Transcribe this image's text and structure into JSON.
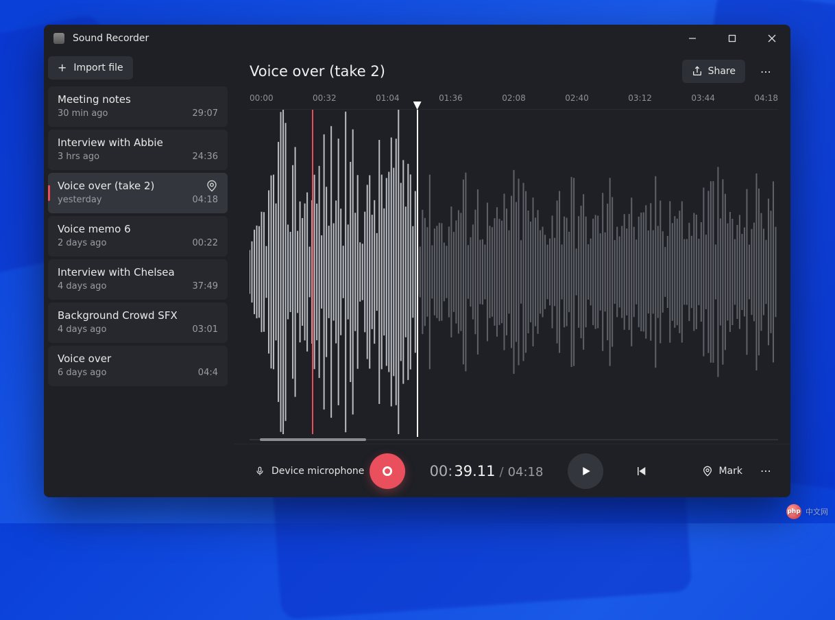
{
  "app": {
    "title": "Sound Recorder"
  },
  "window_controls": {
    "minimize": "minimize",
    "maximize": "maximize",
    "close": "close"
  },
  "sidebar": {
    "import_label": "Import file",
    "recordings": [
      {
        "title": "Meeting notes",
        "age": "30 min ago",
        "duration": "29:07",
        "selected": false
      },
      {
        "title": "Interview with Abbie",
        "age": "3 hrs ago",
        "duration": "24:36",
        "selected": false
      },
      {
        "title": "Voice over (take 2)",
        "age": "yesterday",
        "duration": "04:18",
        "selected": true,
        "has_marker": true
      },
      {
        "title": "Voice memo 6",
        "age": "2 days ago",
        "duration": "00:22",
        "selected": false
      },
      {
        "title": "Interview with Chelsea",
        "age": "4 days ago",
        "duration": "37:49",
        "selected": false
      },
      {
        "title": "Background Crowd SFX",
        "age": "4 days ago",
        "duration": "03:01",
        "selected": false
      },
      {
        "title": "Voice over",
        "age": "6 days ago",
        "duration": "04:4",
        "selected": false
      }
    ]
  },
  "main": {
    "title": "Voice over (take 2)",
    "share_label": "Share",
    "timeline_ticks": [
      "00:00",
      "00:32",
      "01:04",
      "01:36",
      "02:08",
      "02:40",
      "03:12",
      "03:44",
      "04:18"
    ],
    "playhead_fraction": 0.316,
    "marker_fraction": 0.118,
    "scroll_thumb": {
      "left_fraction": 0.02,
      "width_fraction": 0.2
    }
  },
  "controls": {
    "device_label": "Device microphone",
    "current_time_prefix": "00:",
    "current_time_seconds": "39.11",
    "separator": "/",
    "total_time": "04:18",
    "mark_label": "Mark"
  },
  "colors": {
    "accent": "#e94f5c",
    "surface": "#1e2025",
    "surface_alt": "#2d3036"
  },
  "watermark": {
    "logo_text": "php",
    "text": "中文网"
  }
}
